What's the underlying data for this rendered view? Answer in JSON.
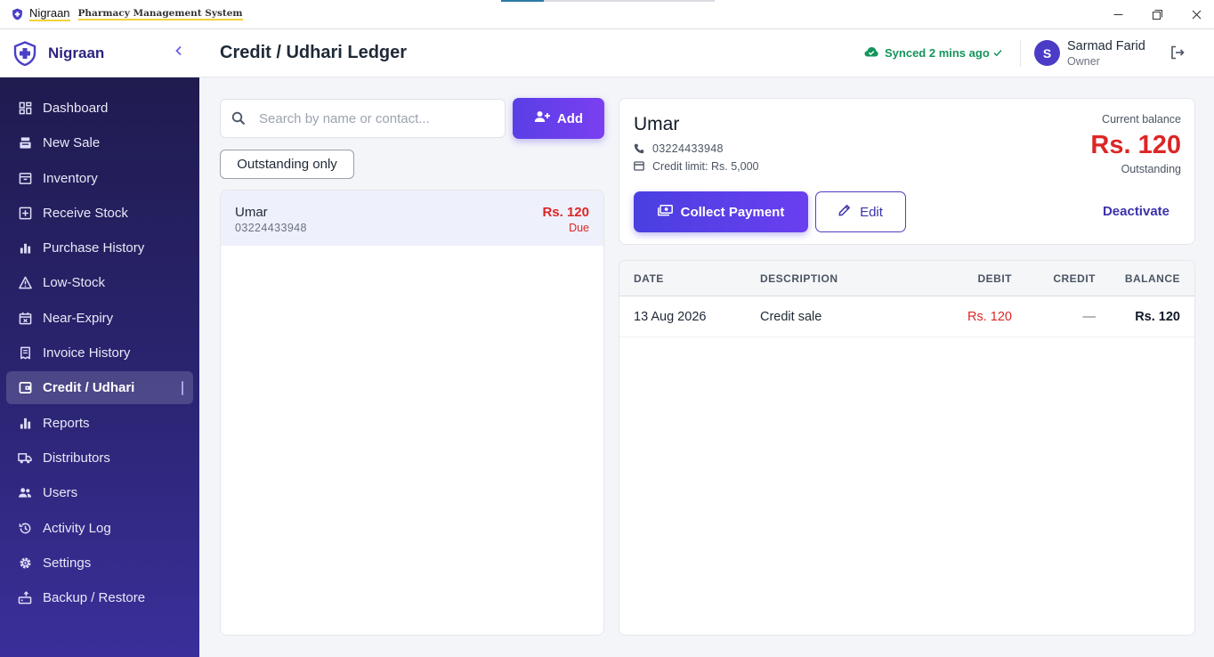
{
  "window": {
    "app_name": "Nigraan",
    "subtitle": "Pharmacy Management System",
    "progress": 0.2,
    "controls": {
      "minimize": "—",
      "maximize": "☐",
      "close": "✕"
    }
  },
  "colors": {
    "accent": "#5a3fe6",
    "danger": "#dc2626",
    "success": "#15945b",
    "sidebar_bg": "#2a2470"
  },
  "sidebar": {
    "brand": "Nigraan",
    "collapse_icon": "chevron-left-icon",
    "items": [
      {
        "label": "Dashboard",
        "icon": "dashboard-icon"
      },
      {
        "label": "New Sale",
        "icon": "register-icon"
      },
      {
        "label": "Inventory",
        "icon": "inventory-icon"
      },
      {
        "label": "Receive Stock",
        "icon": "plus-box-icon"
      },
      {
        "label": "Purchase History",
        "icon": "bar-chart-icon"
      },
      {
        "label": "Low-Stock",
        "icon": "warning-icon"
      },
      {
        "label": "Near-Expiry",
        "icon": "calendar-x-icon"
      },
      {
        "label": "Invoice History",
        "icon": "receipt-icon"
      },
      {
        "label": "Credit / Udhari",
        "icon": "wallet-icon",
        "active": true
      },
      {
        "label": "Reports",
        "icon": "reports-icon"
      },
      {
        "label": "Distributors",
        "icon": "truck-icon"
      },
      {
        "label": "Users",
        "icon": "users-icon"
      },
      {
        "label": "Activity Log",
        "icon": "history-icon"
      },
      {
        "label": "Settings",
        "icon": "gear-icon"
      },
      {
        "label": "Backup / Restore",
        "icon": "backup-icon"
      }
    ]
  },
  "header": {
    "title": "Credit / Udhari Ledger",
    "sync_status": "Synced 2 mins ago",
    "user": {
      "initial": "S",
      "name": "Sarmad Farid",
      "role": "Owner"
    }
  },
  "customers_panel": {
    "search_placeholder": "Search by name or contact...",
    "add_label": "Add",
    "filter_label": "Outstanding only",
    "customers": [
      {
        "name": "Umar",
        "phone": "03224433948",
        "amount": "Rs. 120",
        "status": "Due",
        "selected": true
      }
    ]
  },
  "customer_detail": {
    "name": "Umar",
    "phone": "03224433948",
    "credit_limit": "Credit limit: Rs. 5,000",
    "balance_label": "Current balance",
    "balance": "Rs. 120",
    "balance_status": "Outstanding",
    "collect_label": "Collect Payment",
    "edit_label": "Edit",
    "deactivate_label": "Deactivate"
  },
  "ledger": {
    "columns": [
      "DATE",
      "DESCRIPTION",
      "DEBIT",
      "CREDIT",
      "BALANCE"
    ],
    "rows": [
      {
        "date": "13 Aug 2026",
        "description": "Credit sale",
        "debit": "Rs. 120",
        "credit": "—",
        "balance": "Rs. 120"
      }
    ]
  }
}
